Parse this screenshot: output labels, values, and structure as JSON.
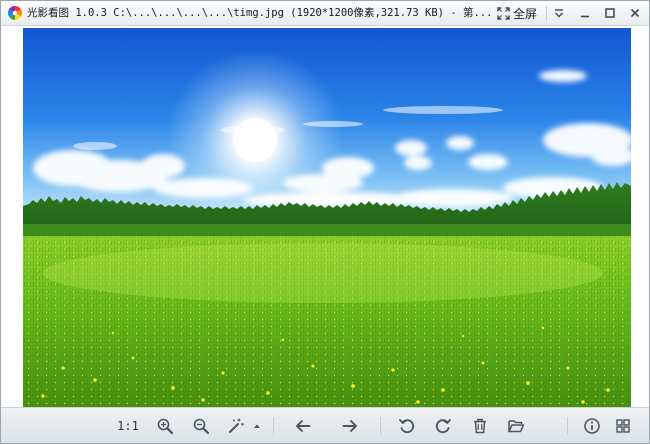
{
  "window": {
    "title": "光影看图 1.0.3  C:\\...\\...\\...\\...\\timg.jpg (1920*1200像素,321.73 KB) - 第...",
    "fullscreen_label": "全屏"
  },
  "icons": {
    "app_logo": "app-logo-icon",
    "fullscreen": "fullscreen-icon",
    "dropdown": "dropdown-icon",
    "minimize": "minimize-icon",
    "maximize": "maximize-icon",
    "close": "close-icon",
    "zoom_in": "zoom-in-icon",
    "zoom_out": "zoom-out-icon",
    "magic": "magic-wand-icon",
    "magic_more": "caret-up-icon",
    "prev": "arrow-left-icon",
    "next": "arrow-right-icon",
    "rotate_left": "rotate-left-icon",
    "rotate_right": "rotate-right-icon",
    "delete": "trash-icon",
    "open_folder": "folder-icon",
    "info": "info-icon",
    "grid": "grid-icon"
  },
  "toolbar": {
    "ratio_label": "1:1"
  },
  "colors": {
    "titlebar_top": "#fbfcfd",
    "titlebar_bottom": "#e8ecef",
    "icon_color": "#4a5560",
    "sky_top": "#1560d8",
    "sky_bottom": "#d9eefc",
    "grass_top": "#77c41e",
    "grass_bottom": "#4f9a14"
  }
}
